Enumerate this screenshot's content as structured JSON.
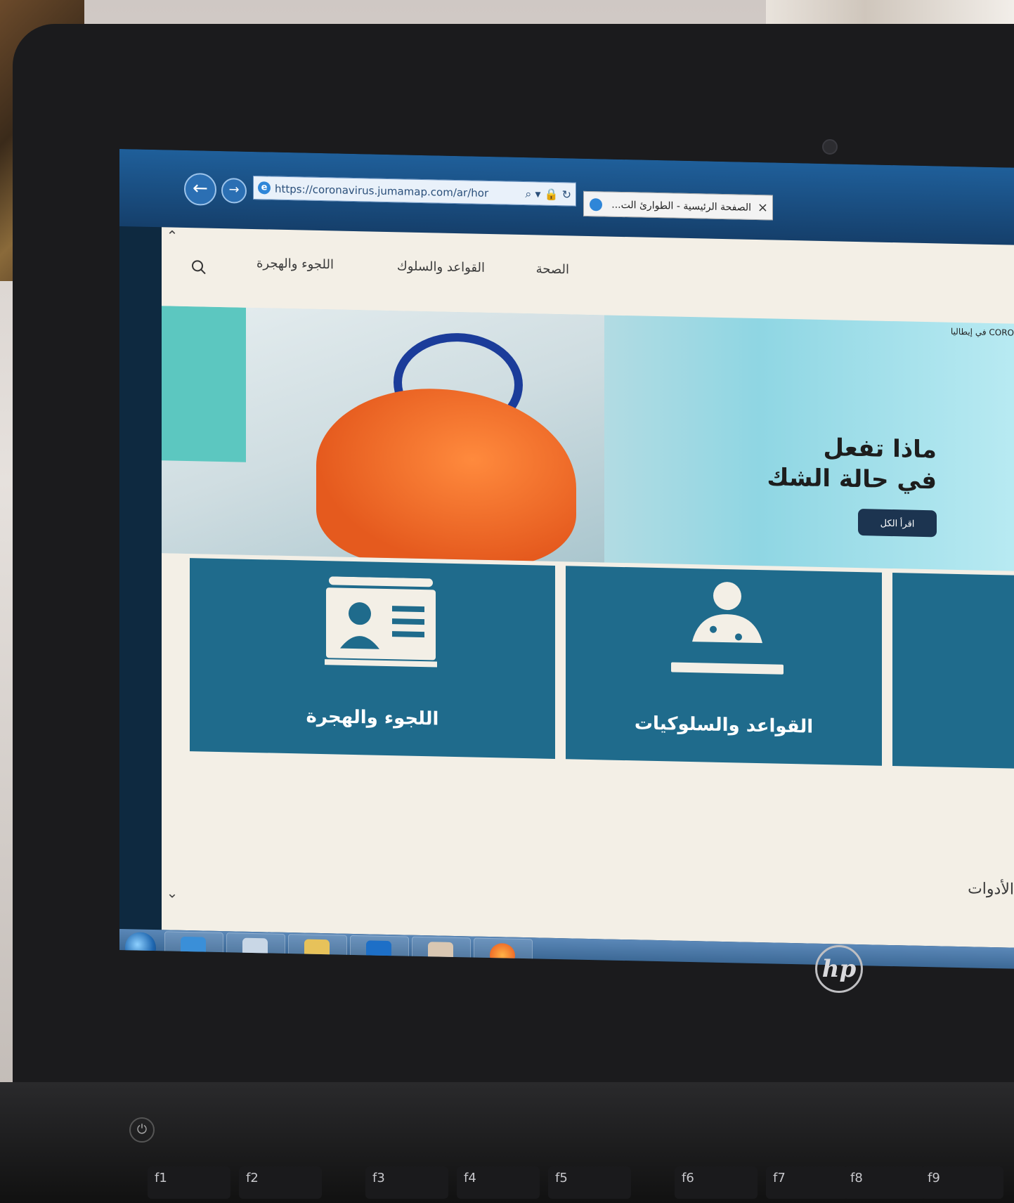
{
  "browser": {
    "url": "https://coronavirus.jumamap.com/ar/hor",
    "tab_title": "الصفحة الرئيسية - الطوارئ الت..."
  },
  "site": {
    "nav": [
      "الصحة",
      "القواعد والسلوك",
      "اللجوء والهجرة"
    ],
    "ticker": "في إيطاليا CORO"
  },
  "hero": {
    "title_line1": "ماذا تفعل",
    "title_line2": "في حالة الشك",
    "button_label": "اقرأ الكل"
  },
  "cards": [
    {
      "label": "اللجوء والهجرة",
      "icon": "id-card-icon"
    },
    {
      "label": "القواعد والسلوكيات",
      "icon": "person-rules-icon"
    }
  ],
  "section_title": "الأدوات",
  "colors": {
    "card_bg": "#1f6b8c",
    "page_bg": "#f3efe6",
    "button_bg": "#1c3450"
  },
  "keyboard": {
    "fkeys": [
      "f1",
      "f2",
      "f3",
      "f4",
      "f5",
      "f6",
      "f7",
      "f8",
      "f9"
    ]
  },
  "brand": "hp"
}
